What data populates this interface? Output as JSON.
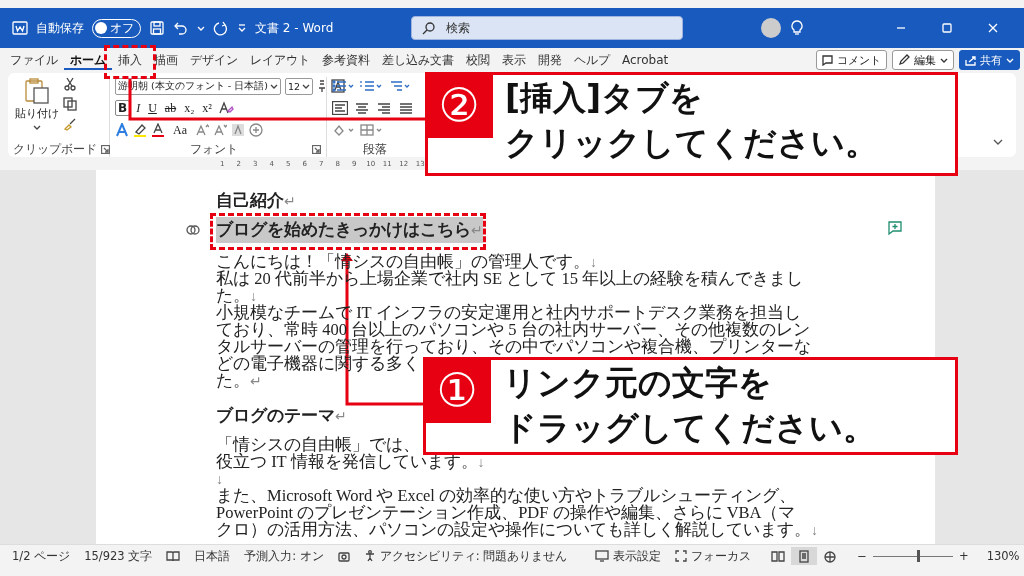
{
  "titlebar": {
    "autosave_label": "自動保存",
    "autosave": {
      "on": false,
      "label": "オフ"
    },
    "title": "文書 2 - Word",
    "search": {
      "placeholder": "検索"
    }
  },
  "tabs": [
    {
      "label": "ファイル",
      "selected": false
    },
    {
      "label": "ホーム",
      "selected": true
    },
    {
      "label": "挿入",
      "selected": false
    },
    {
      "label": "描画",
      "selected": false
    },
    {
      "label": "デザイン",
      "selected": false
    },
    {
      "label": "レイアウト",
      "selected": false
    },
    {
      "label": "参考資料",
      "selected": false
    },
    {
      "label": "差し込み文書",
      "selected": false
    },
    {
      "label": "校閲",
      "selected": false
    },
    {
      "label": "表示",
      "selected": false
    },
    {
      "label": "開発",
      "selected": false
    },
    {
      "label": "ヘルプ",
      "selected": false
    },
    {
      "label": "Acrobat",
      "selected": false
    }
  ],
  "tab_actions": [
    {
      "kind": "comment",
      "label": "コメント"
    },
    {
      "kind": "edit",
      "label": "編集"
    },
    {
      "kind": "share",
      "label": "共有"
    }
  ],
  "ribbon": {
    "clipboard": {
      "paste": "貼り付け",
      "label": "クリップボード"
    },
    "font": {
      "name": "游明朝 (本文のフォント - 日本語)",
      "size": "12",
      "styles": [
        "B",
        "I",
        "U",
        "ab",
        "x₂",
        "x²"
      ],
      "change_case": "Aa",
      "label": "フォント"
    },
    "paragraph": {
      "label": "段落"
    }
  },
  "ruler": [
    "1",
    "2",
    "3",
    "4",
    "5",
    "6",
    "7",
    "8",
    "9",
    "10",
    "11",
    "12",
    "13"
  ],
  "document": {
    "paragraphs": [
      {
        "kind": "heading",
        "selected": false,
        "lines": [
          {
            "text": "自己紹介",
            "mark": "↵"
          }
        ]
      },
      {
        "kind": "heading",
        "selected": true,
        "lines": [
          {
            "text": "ブログを始めたきっかけはこちら",
            "mark": "↵"
          }
        ]
      },
      {
        "kind": "body",
        "selected": false,
        "lines": [
          {
            "text": "こんにちは！「情シスの自由帳」の管理人です。",
            "mark": "↓"
          },
          {
            "text": "私は 20 代前半から上場企業で社内 SE として 15 年以上の経験を積んできまし"
          },
          {
            "text": "た。",
            "mark": "↓"
          },
          {
            "text": "小規模なチームで IT インフラの安定運用と社内サポートデスク業務を担当し"
          },
          {
            "text": "ており、常時 400 台以上のパソコンや 5 台の社内サーバー、その他複数のレン"
          },
          {
            "text": "タルサーバーの管理を行っており、その中でパソコンや複合機、プリンターな"
          },
          {
            "text": "どの電子機器に関する多く"
          },
          {
            "text": "た。",
            "mark": "↵"
          }
        ]
      },
      {
        "kind": "subheading",
        "selected": false,
        "lines": [
          {
            "text": "ブログのテーマ",
            "mark": "↵"
          }
        ]
      },
      {
        "kind": "body",
        "selected": false,
        "lines": [
          {
            "text": "「情シスの自由帳」では、"
          },
          {
            "text": "役立つ IT 情報を発信しています。",
            "mark": "↓"
          },
          {
            "mark": "↓"
          },
          {
            "text": "また、Microsoft Word や Excel の効率的な使い方やトラブルシューティング、"
          },
          {
            "text": "PowerPoint のプレゼンテーション作成、PDF の操作や編集、さらに VBA（マ"
          },
          {
            "text": "クロ）の活用方法、パソコンの設定や操作についても詳しく解説しています。",
            "mark": "↓"
          }
        ]
      }
    ]
  },
  "callouts": [
    {
      "number": "②",
      "lines": [
        "[挿入]タブを",
        "クリックしてください。"
      ]
    },
    {
      "number": "①",
      "lines": [
        "リンク元の文字を",
        "ドラッグしてください。"
      ]
    }
  ],
  "status_bar": {
    "pages": "1/2 ページ",
    "words": "15/923 文字",
    "language": "日本語",
    "predict": "予測入力: オン",
    "accessibility": "アクセシビリティ: 問題ありません",
    "display": "表示設定",
    "focus": "フォーカス",
    "views": [
      {
        "selected": false
      },
      {
        "selected": true
      },
      {
        "selected": false
      }
    ],
    "zoom_out": "−",
    "zoom_in": "+",
    "zoom": {
      "level": 0.55,
      "label": "130%"
    }
  }
}
